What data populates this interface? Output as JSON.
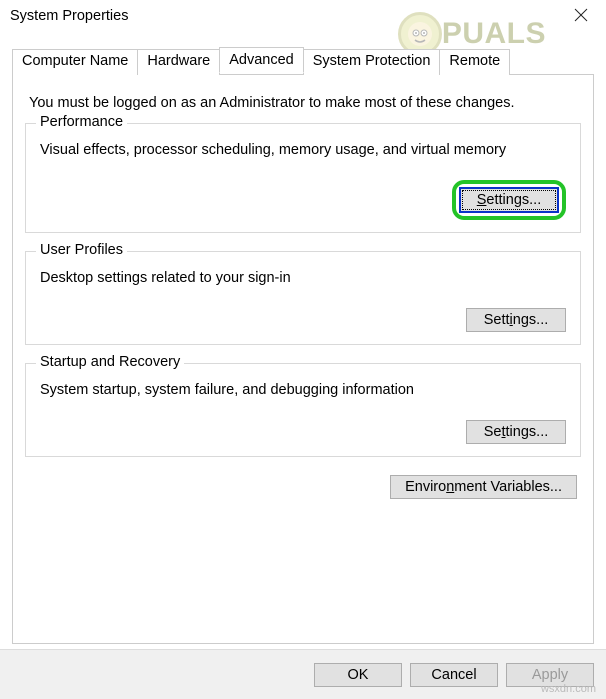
{
  "window": {
    "title": "System Properties"
  },
  "tabs": {
    "computer_name": "Computer Name",
    "hardware": "Hardware",
    "advanced": "Advanced",
    "system_protection": "System Protection",
    "remote": "Remote"
  },
  "intro_text": "You must be logged on as an Administrator to make most of these changes.",
  "groups": {
    "performance": {
      "title": "Performance",
      "desc": "Visual effects, processor scheduling, memory usage, and virtual memory",
      "button": "Settings..."
    },
    "user_profiles": {
      "title": "User Profiles",
      "desc": "Desktop settings related to your sign-in",
      "button": "Settings..."
    },
    "startup_recovery": {
      "title": "Startup and Recovery",
      "desc": "System startup, system failure, and debugging information",
      "button": "Settings..."
    }
  },
  "env_button": "Environment Variables...",
  "bottom": {
    "ok": "OK",
    "cancel": "Cancel",
    "apply": "Apply"
  },
  "watermark": {
    "brand": "PUALS",
    "url": "wsxdn.com"
  }
}
